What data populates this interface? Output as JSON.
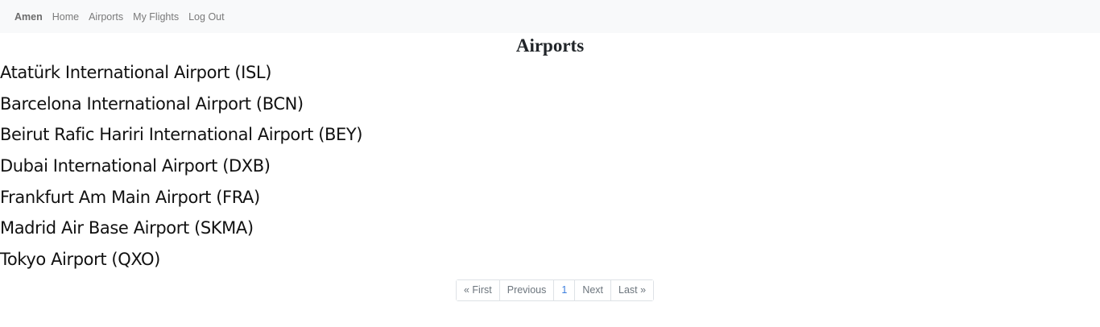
{
  "navbar": {
    "brand": "Amen",
    "links": [
      "Home",
      "Airports",
      "My Flights",
      "Log Out"
    ]
  },
  "page": {
    "title": "Airports"
  },
  "airports": [
    "Atatürk International Airport (ISL)",
    "Barcelona International Airport (BCN)",
    "Beirut Rafic Hariri International Airport (BEY)",
    "Dubai International Airport (DXB)",
    "Frankfurt Am Main Airport (FRA)",
    "Madrid Air Base Airport (SKMA)",
    "Tokyo Airport (QXO)"
  ],
  "pagination": {
    "first": "« First",
    "previous": "Previous",
    "current": "1",
    "next": "Next",
    "last": "Last »"
  },
  "colors": {
    "navbar_bg": "#f8f9fa",
    "active_page": "#3b7ddd"
  }
}
